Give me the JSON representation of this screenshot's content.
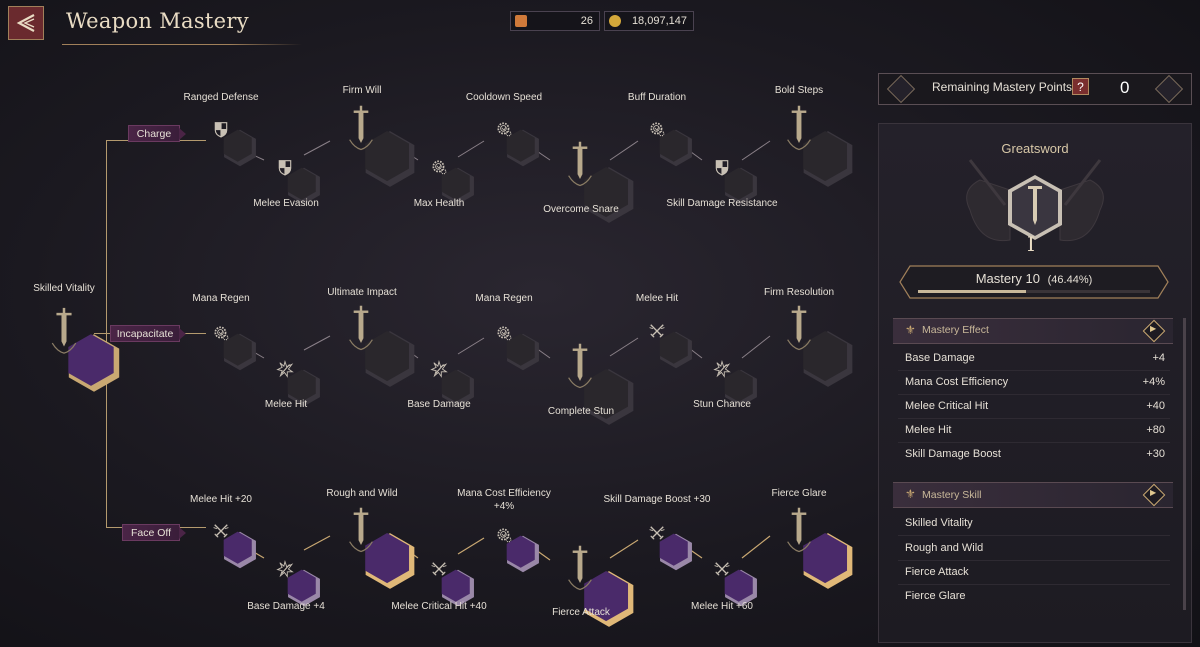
{
  "header": {
    "title": "Weapon Mastery",
    "currency_a": "26",
    "currency_b": "18,097,147"
  },
  "root_node": {
    "label": "Skilled Vitality"
  },
  "branches": [
    {
      "label": "Charge"
    },
    {
      "label": "Incapacitate"
    },
    {
      "label": "Face Off"
    }
  ],
  "nodes": {
    "c1": "Ranged Defense",
    "c2": "Melee Evasion",
    "c3": "Firm Will",
    "c4": "Max Health",
    "c5": "Cooldown Speed",
    "c6": "Overcome Snare",
    "c7": "Buff Duration",
    "c8": "Skill Damage Resistance",
    "c9": "Bold Steps",
    "i1": "Mana Regen",
    "i2": "Melee Hit",
    "i3": "Ultimate Impact",
    "i4": "Base Damage",
    "i5": "Mana Regen",
    "i6": "Complete Stun",
    "i7": "Melee Hit",
    "i8": "Stun Chance",
    "i9": "Firm Resolution",
    "f1": "Melee Hit +20",
    "f2": "Base Damage +4",
    "f3": "Rough and Wild",
    "f4": "Melee Critical Hit +40",
    "f5a": "Mana Cost Efficiency",
    "f5b": "+4%",
    "f6": "Fierce Attack",
    "f7": "Skill Damage Boost +30",
    "f8": "Melee Hit +60",
    "f9": "Fierce Glare"
  },
  "panel": {
    "remaining_label": "Remaining Mastery Points",
    "help": "?",
    "remaining_value": "0",
    "weapon": "Greatsword",
    "rank_numeral": "I",
    "mastery_label": "Mastery 10",
    "mastery_percent": "(46.44%)",
    "mastery_progress": 0.4644,
    "effect_title": "Mastery Effect",
    "effects": [
      {
        "name": "Base Damage",
        "value": "+4"
      },
      {
        "name": "Mana Cost Efficiency",
        "value": "+4%"
      },
      {
        "name": "Melee Critical Hit",
        "value": "+40"
      },
      {
        "name": "Melee Hit",
        "value": "+80"
      },
      {
        "name": "Skill Damage Boost",
        "value": "+30"
      }
    ],
    "skill_title": "Mastery Skill",
    "skills": [
      "Skilled Vitality",
      "Rough and Wild",
      "Fierce Attack",
      "Fierce Glare"
    ]
  },
  "colors": {
    "accent_gold": "#b49a6e",
    "active_purple": "#4a2a6a",
    "inactive": "#2a272c"
  }
}
